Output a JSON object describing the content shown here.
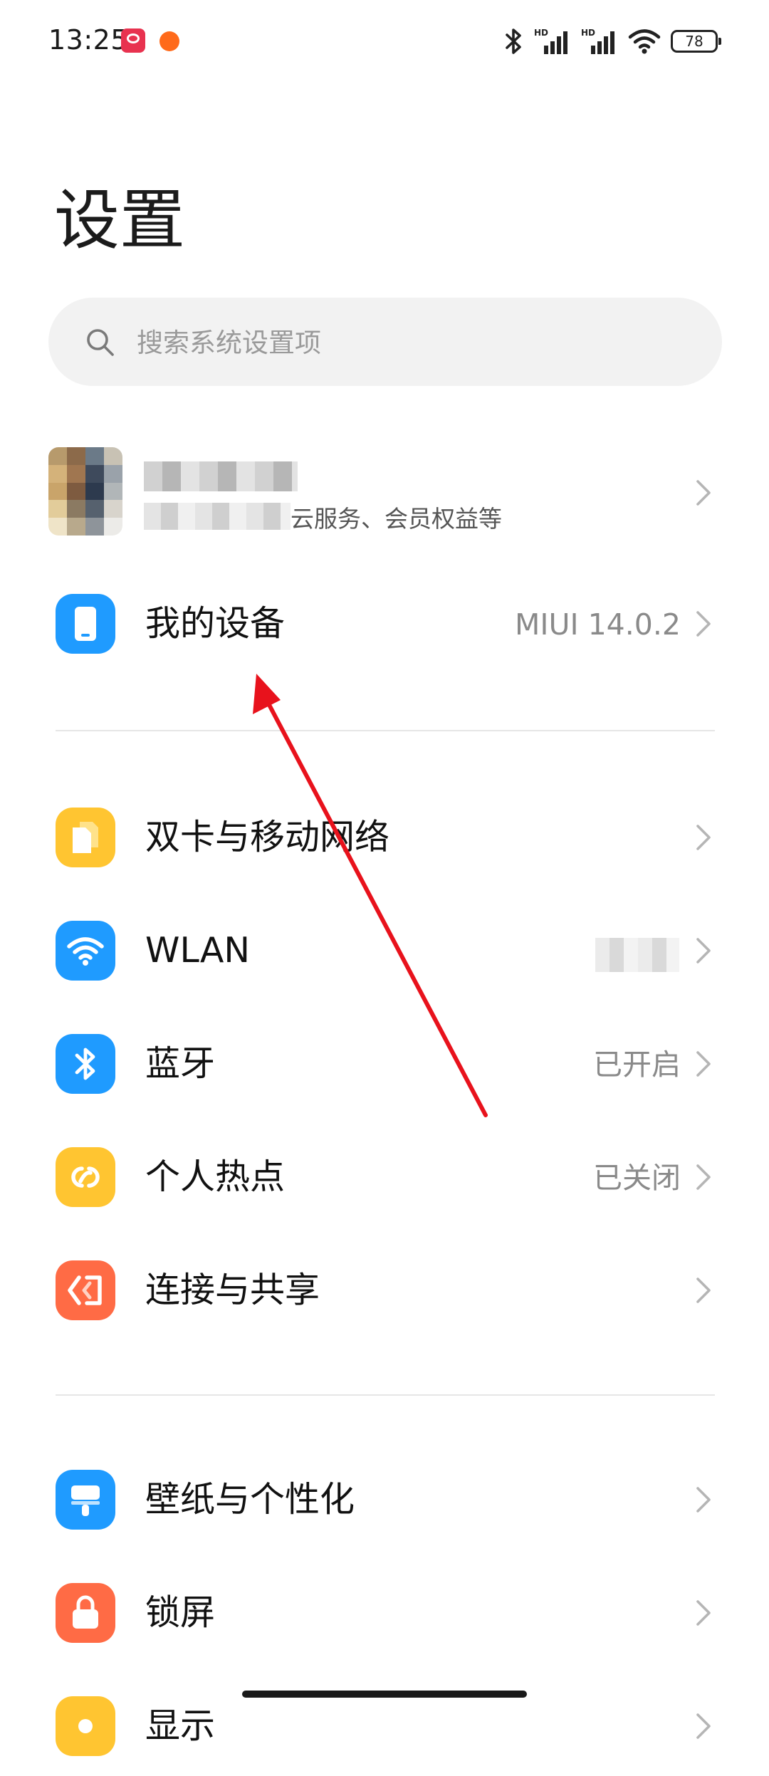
{
  "status_bar": {
    "time": "13:25",
    "battery": "78"
  },
  "page": {
    "title": "设置"
  },
  "search": {
    "placeholder": "搜索系统设置项"
  },
  "account": {
    "subtitle": "云服务、会员权益等"
  },
  "rows": {
    "my_device": {
      "label": "我的设备",
      "value": "MIUI 14.0.2",
      "icon": "phone-icon",
      "color": "#1f9bff"
    },
    "dual_sim": {
      "label": "双卡与移动网络",
      "icon": "sim-card-icon",
      "color": "#ffc531"
    },
    "wlan": {
      "label": "WLAN",
      "icon": "wifi-icon",
      "color": "#1f9bff"
    },
    "bluetooth": {
      "label": "蓝牙",
      "value": "已开启",
      "icon": "bluetooth-icon",
      "color": "#1f9bff"
    },
    "hotspot": {
      "label": "个人热点",
      "value": "已关闭",
      "icon": "hotspot-icon",
      "color": "#ffc531"
    },
    "connection": {
      "label": "连接与共享",
      "icon": "share-connection-icon",
      "color": "#ff6b45"
    },
    "wallpaper": {
      "label": "壁纸与个性化",
      "icon": "brush-icon",
      "color": "#1f9bff"
    },
    "lockscreen": {
      "label": "锁屏",
      "icon": "lock-icon",
      "color": "#ff6b45"
    },
    "display": {
      "label": "显示",
      "icon": "brightness-icon",
      "color": "#ffc531"
    }
  },
  "annotation": {
    "arrow_color": "#e8121c"
  }
}
